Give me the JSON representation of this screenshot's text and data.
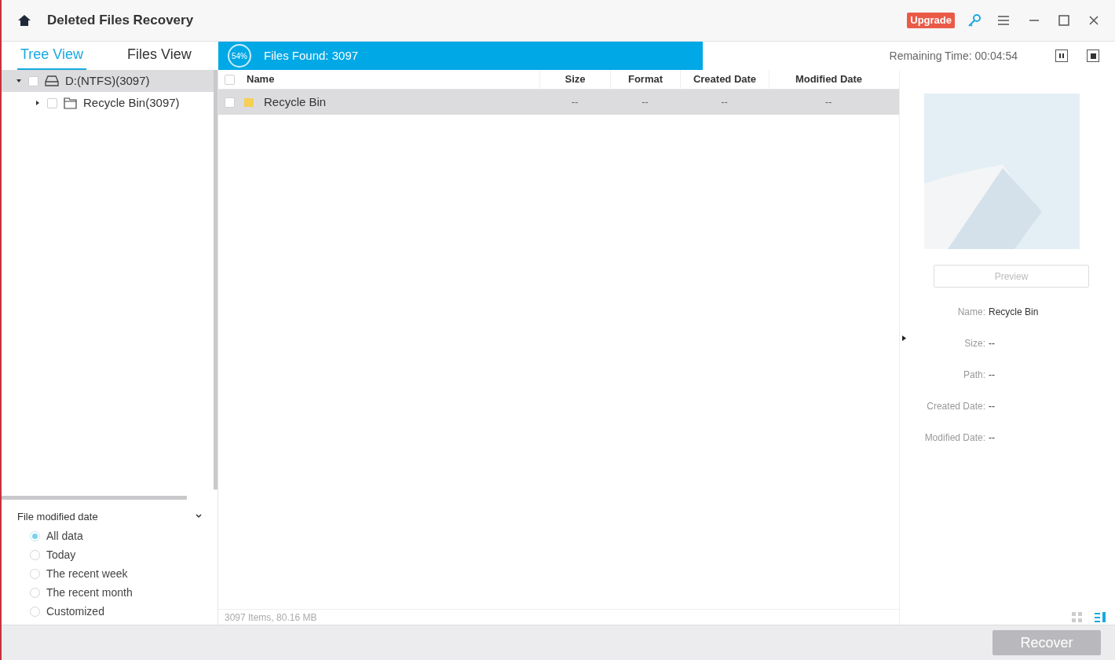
{
  "window": {
    "title": "Deleted Files Recovery",
    "upgrade": "Upgrade"
  },
  "tabs": [
    {
      "label": "Tree View",
      "selected": true
    },
    {
      "label": "Files View",
      "selected": false
    }
  ],
  "scan": {
    "percent": "54%",
    "files_found": "Files Found:  3097",
    "level": 0.54,
    "remaining": "Remaining Time: 00:04:54"
  },
  "tree": [
    {
      "label": "D:(NTFS)(3097)",
      "kind": "drive",
      "checked": false,
      "expanded": true,
      "selected": true,
      "children": [
        {
          "label": "Recycle Bin(3097)",
          "kind": "folder",
          "checked": false,
          "expanded": false,
          "selected": false
        }
      ]
    }
  ],
  "filter": {
    "title": "File modified date",
    "options": [
      {
        "label": "All data",
        "selected": true
      },
      {
        "label": "Today",
        "selected": false
      },
      {
        "label": "The recent week",
        "selected": false
      },
      {
        "label": "The recent month",
        "selected": false
      },
      {
        "label": "Customized",
        "selected": false
      }
    ]
  },
  "table": {
    "all_checked": false,
    "columns": [
      "Name",
      "Size",
      "Format",
      "Created Date",
      "Modified Date"
    ],
    "rows": [
      {
        "cells": [
          "Recycle Bin",
          "--",
          "--",
          "--",
          "--"
        ],
        "checked": false,
        "selected": true
      }
    ]
  },
  "status": "3097 Items, 80.16 MB",
  "details": {
    "preview": "Preview",
    "fields": [
      {
        "label": "Name:",
        "value": "Recycle Bin"
      },
      {
        "label": "Size:",
        "value": "--"
      },
      {
        "label": "Path:",
        "value": "--"
      },
      {
        "label": "Created Date:",
        "value": "--"
      },
      {
        "label": "Modified Date:",
        "value": "--"
      }
    ]
  },
  "view_modes": [
    {
      "kind": "grid",
      "selected": false
    },
    {
      "kind": "list",
      "selected": true
    }
  ],
  "recover": "Recover"
}
